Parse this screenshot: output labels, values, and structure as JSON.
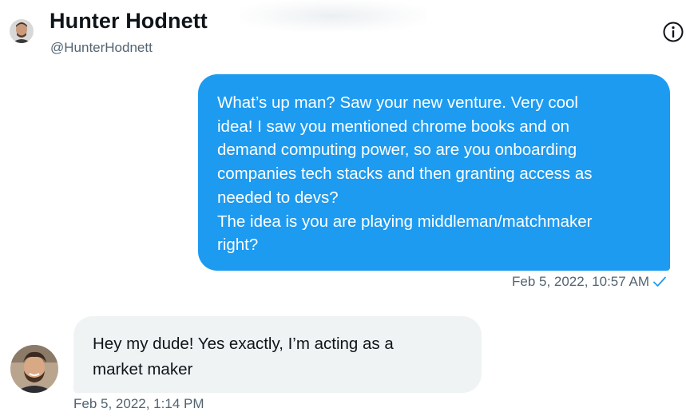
{
  "header": {
    "name": "Hunter Hodnett",
    "handle": "@HunterHodnett",
    "avatar_icon": "user-avatar",
    "info_icon": "info-icon"
  },
  "messages": [
    {
      "direction": "outgoing",
      "lines": [
        "What’s up man? Saw your new venture. Very cool",
        "idea! I saw you mentioned chrome books and on",
        "demand computing power, so are you onboarding",
        "companies tech stacks and then granting access as",
        "needed to devs?",
        "The idea is you are playing middleman/matchmaker",
        "right?"
      ],
      "timestamp": "Feb 5, 2022, 10:57 AM",
      "status_icon": "checkmark-icon"
    },
    {
      "direction": "incoming",
      "lines": [
        "Hey my dude! Yes exactly, I’m acting as a",
        "market maker"
      ],
      "timestamp": "Feb 5, 2022, 1:14 PM"
    }
  ],
  "colors": {
    "outgoing_bubble": "#1d9bf0",
    "incoming_bubble": "#eff3f4",
    "muted_text": "#536471"
  }
}
